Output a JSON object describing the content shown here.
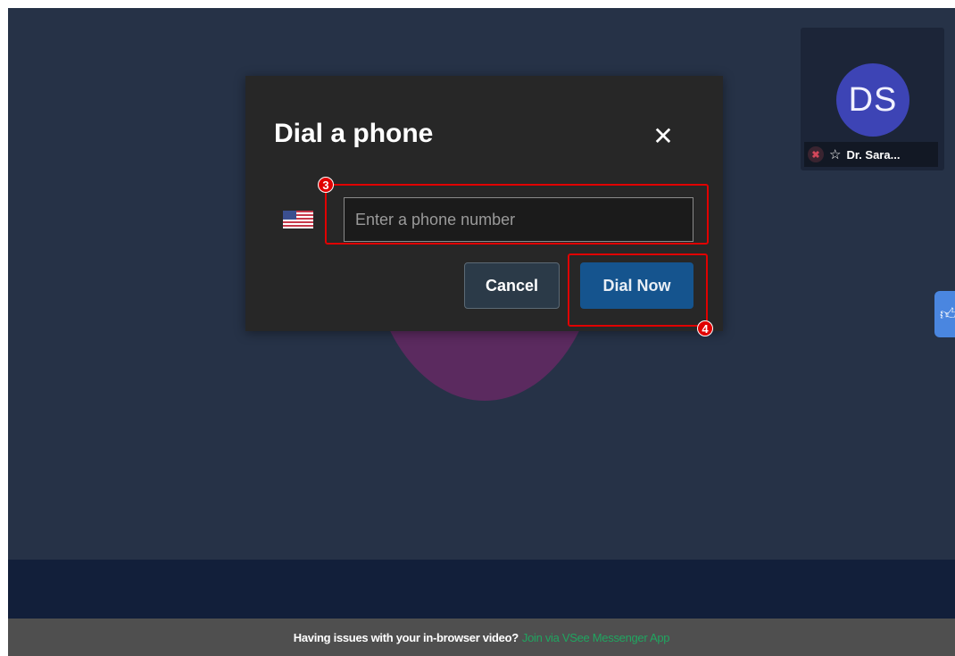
{
  "dialog": {
    "title": "Dial a phone",
    "close_icon": "close-icon",
    "country_flag": "us-flag-icon",
    "phone_input": {
      "value": "",
      "placeholder": "Enter a phone number"
    },
    "cancel_label": "Cancel",
    "dial_label": "Dial Now"
  },
  "participant_tile": {
    "initials": "DS",
    "name": "Dr. Sara...",
    "mic_icon": "mic-muted-icon",
    "star_icon": "star-icon"
  },
  "side_tab": {
    "icon": "thumbs-up-icon"
  },
  "footer": {
    "question": "Having issues with your in-browser video?",
    "link": "Join via VSee Messenger App"
  },
  "annotations": [
    {
      "label": "3"
    },
    {
      "label": "4"
    }
  ],
  "colors": {
    "background": "#263247",
    "dialog": "#272727",
    "primary_button": "#15548e",
    "footer_link": "#20a560",
    "highlight": "#e00000"
  }
}
